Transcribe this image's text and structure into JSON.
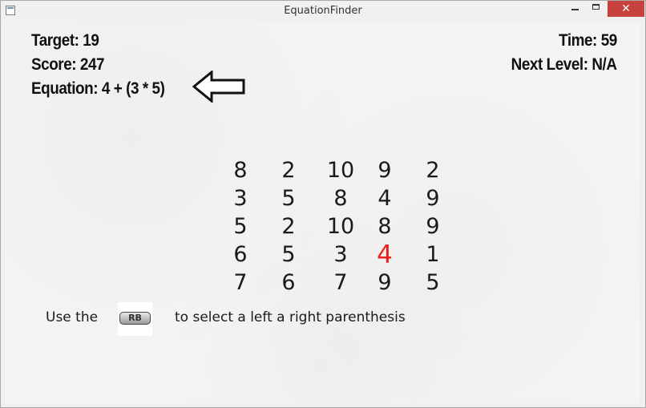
{
  "window": {
    "title": "EquationFinder",
    "controls": {
      "minimize": "minimize-icon",
      "maximize": "maximize-icon",
      "close": "close-icon"
    },
    "close_color": "#c7413d"
  },
  "hud": {
    "target": "Target: 19",
    "score": "Score: 247",
    "equation": "Equation: 4 + (3 * 5)",
    "time": "Time:  59",
    "next_level": "Next Level: N/A"
  },
  "pointer_icon": "left-arrow-outline-icon",
  "grid": {
    "rows": [
      [
        "8",
        "2",
        "10",
        "9",
        "2"
      ],
      [
        "3",
        "5",
        "8",
        "4",
        "9"
      ],
      [
        "5",
        "2",
        "10",
        "8",
        "9"
      ],
      [
        "6",
        "5",
        "3",
        "4",
        "1"
      ],
      [
        "7",
        "6",
        "7",
        "9",
        "5"
      ]
    ],
    "selected": {
      "row": 3,
      "col": 3
    },
    "selected_color": "#e8211f"
  },
  "hint": {
    "before": "Use the",
    "button_label": "RB",
    "after": "to select a left a right parenthesis"
  }
}
